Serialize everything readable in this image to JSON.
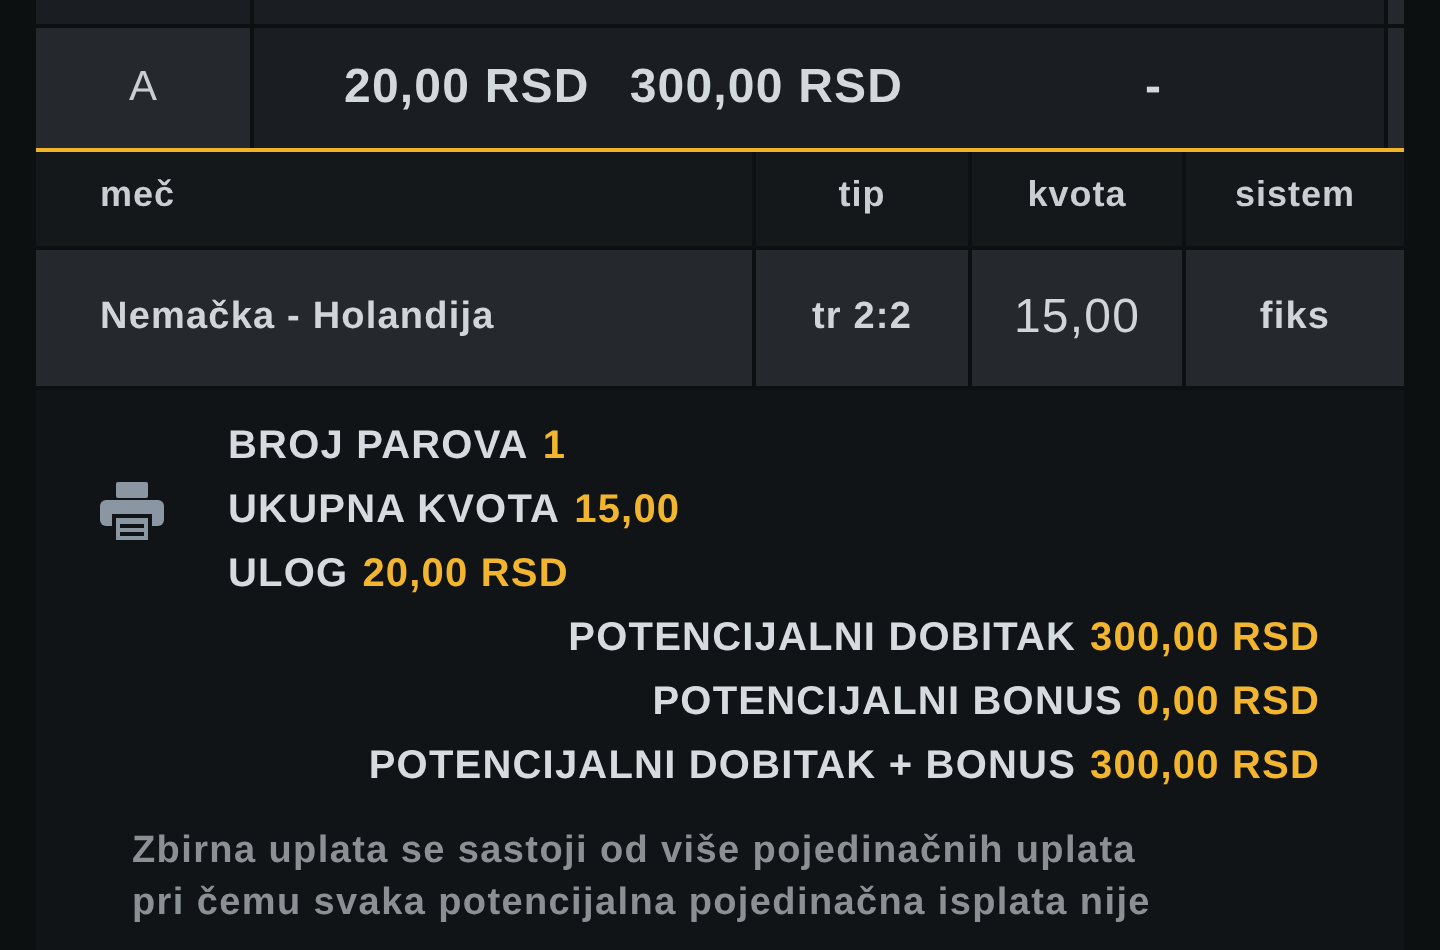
{
  "system_row": {
    "label": "A",
    "stake": "20,00 RSD",
    "win": "300,00 RSD",
    "bonus": "-"
  },
  "table": {
    "columns": [
      "meč",
      "tip",
      "kvota",
      "sistem"
    ],
    "rows": [
      {
        "cells": [
          "Nemačka - Holandija",
          "tr 2:2",
          "15,00",
          "fiks"
        ]
      }
    ]
  },
  "summary": {
    "lines": [
      {
        "kind": "left",
        "label": "BROJ PAROVA",
        "value": "1"
      },
      {
        "kind": "left",
        "label": "UKUPNA KVOTA",
        "value": "15,00"
      },
      {
        "kind": "left",
        "label": "ULOG",
        "value": "20,00 RSD"
      },
      {
        "kind": "right",
        "label": "POTENCIJALNI DOBITAK",
        "value": "300,00 RSD"
      },
      {
        "kind": "right",
        "label": "POTENCIJALNI BONUS",
        "value": "0,00 RSD"
      },
      {
        "kind": "right",
        "label": "POTENCIJALNI DOBITAK + BONUS",
        "value": "300,00 RSD"
      }
    ]
  },
  "note_lines": [
    "Zbirna uplata se sastoji od više pojedinačnih uplata",
    "pri čemu svaka potencijalna pojedinačna isplata nije"
  ]
}
